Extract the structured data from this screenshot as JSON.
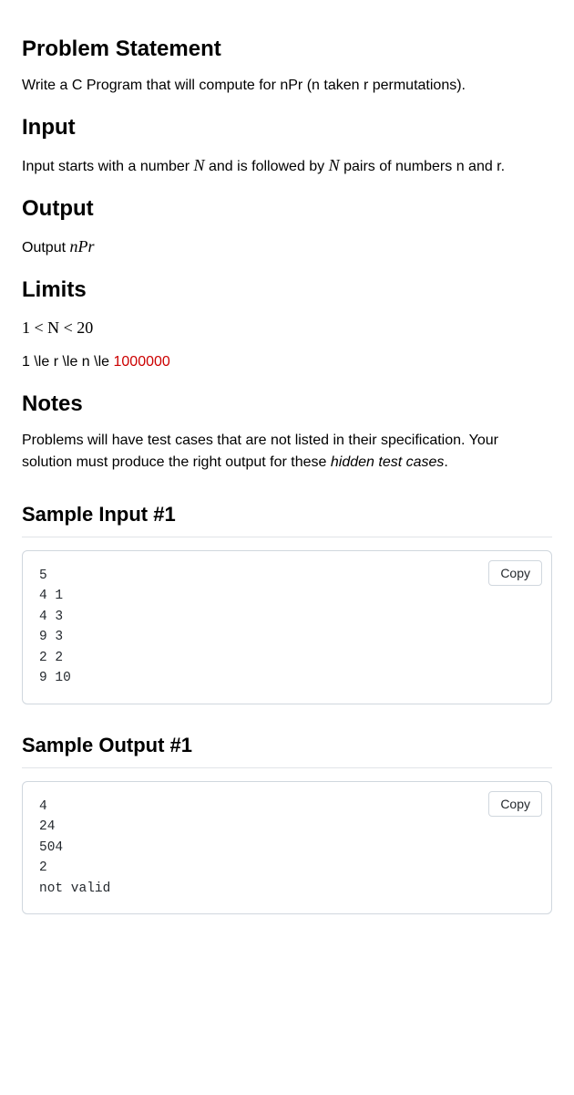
{
  "sections": {
    "problem_statement": {
      "heading": "Problem Statement",
      "body": "Write a C Program that will compute for nPr (n taken r permutations)."
    },
    "input": {
      "heading": "Input",
      "body_pre": "Input starts with a number ",
      "var1": "N",
      "body_mid": " and is followed by ",
      "var2": "N",
      "body_post": " pairs of numbers n and r."
    },
    "output": {
      "heading": "Output",
      "body_pre": "Output ",
      "expr": "nPr"
    },
    "limits": {
      "heading": "Limits",
      "line1": "1 < N < 20",
      "line2_pre": "1 \\le r \\le n \\le ",
      "line2_err": "1000000"
    },
    "notes": {
      "heading": "Notes",
      "body_pre": "Problems will have test cases that are not listed in their specification. Your solution must produce the right output for these ",
      "body_em": "hidden test cases",
      "body_post": "."
    },
    "sample_input": {
      "heading": "Sample Input #1",
      "copy_label": "Copy",
      "content": "5\n4 1\n4 3\n9 3\n2 2\n9 10"
    },
    "sample_output": {
      "heading": "Sample Output #1",
      "copy_label": "Copy",
      "content": "4\n24\n504\n2\nnot valid"
    }
  }
}
